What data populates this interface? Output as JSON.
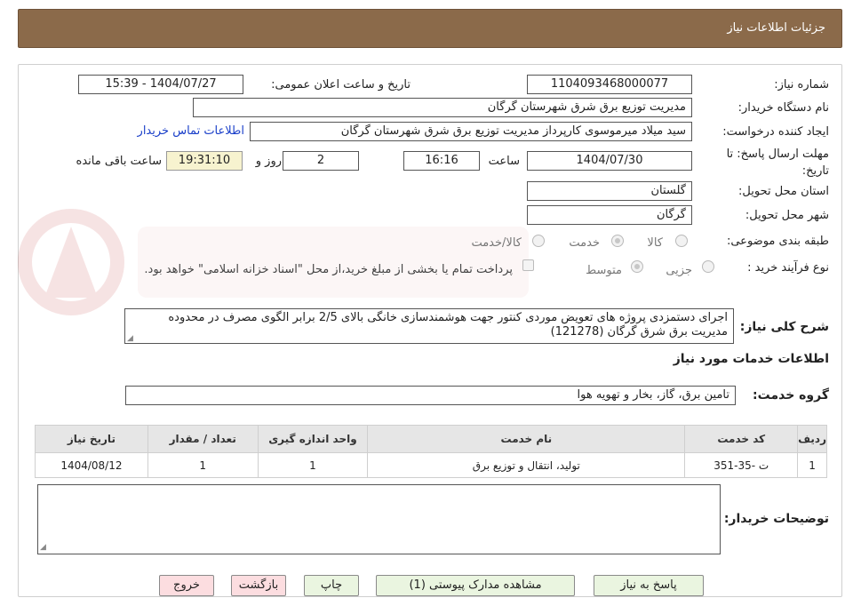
{
  "header": {
    "title": "جزئیات اطلاعات نیاز"
  },
  "form": {
    "need_number_label": "شماره نیاز:",
    "need_number": "1104093468000077",
    "announce_label": "تاریخ و ساعت اعلان عمومی:",
    "announce_value": "1404/07/27 - 15:39",
    "buyer_org_label": "نام دستگاه خریدار:",
    "buyer_org": "مدیریت توزیع برق شرق شهرستان گرگان",
    "creator_label": "ایجاد کننده درخواست:",
    "creator": "سید میلاد میرموسوی کارپرداز مدیریت توزیع برق شرق شهرستان گرگان",
    "contact_link": "اطلاعات تماس خریدار",
    "deadline_label": "مهلت ارسال پاسخ: تا تاریخ:",
    "deadline_date": "1404/07/30",
    "time_label": "ساعت",
    "deadline_time": "16:16",
    "days": "2",
    "days_label": "روز و",
    "remaining": "19:31:10",
    "remaining_label": "ساعت باقی مانده",
    "province_label": "استان محل تحویل:",
    "province": "گلستان",
    "city_label": "شهر محل تحویل:",
    "city": "گرگان",
    "category_label": "طبقه بندی موضوعی:",
    "category_options": [
      "کالا",
      "خدمت",
      "کالا/خدمت"
    ],
    "category_selected": "خدمت",
    "process_label": "نوع فرآیند خرید :",
    "process_options": [
      "جزیی",
      "متوسط"
    ],
    "process_selected": "متوسط",
    "payment_note": "پرداخت تمام یا بخشی از مبلغ خرید،از محل \"اسناد خزانه اسلامی\" خواهد بود.",
    "desc_label": "شرح کلی نیاز:",
    "desc": "اجرای  دستمزدی پروژه های تعویض موردی کنتور جهت هوشمندسازی  خانگی بالای 2/5 برابر الگوی مصرف در محدوده مدیریت برق شرق گرگان  (121278)"
  },
  "services": {
    "title": "اطلاعات خدمات مورد نیاز",
    "group_label": "گروه خدمت:",
    "group": "تامین برق، گاز، بخار و تهویه هوا",
    "columns": [
      "ردیف",
      "کد خدمت",
      "نام خدمت",
      "واحد اندازه گیری",
      "تعداد / مقدار",
      "تاریخ نیاز"
    ],
    "rows": [
      [
        "1",
        "ت -35-351",
        "تولید، انتقال و توزیع برق",
        "1",
        "1",
        "1404/08/12"
      ]
    ]
  },
  "notes": {
    "label": "توضیحات خریدار:"
  },
  "buttons": {
    "reply": "پاسخ به نیاز",
    "attachments": "مشاهده مدارک پیوستی (1)",
    "print": "چاپ",
    "back": "بازگشت",
    "exit": "خروج"
  },
  "colors": {
    "header": "#8b6a4a",
    "button_green": "#eaf5e0",
    "button_red": "#fcdde0",
    "link": "#1a3fc9"
  }
}
